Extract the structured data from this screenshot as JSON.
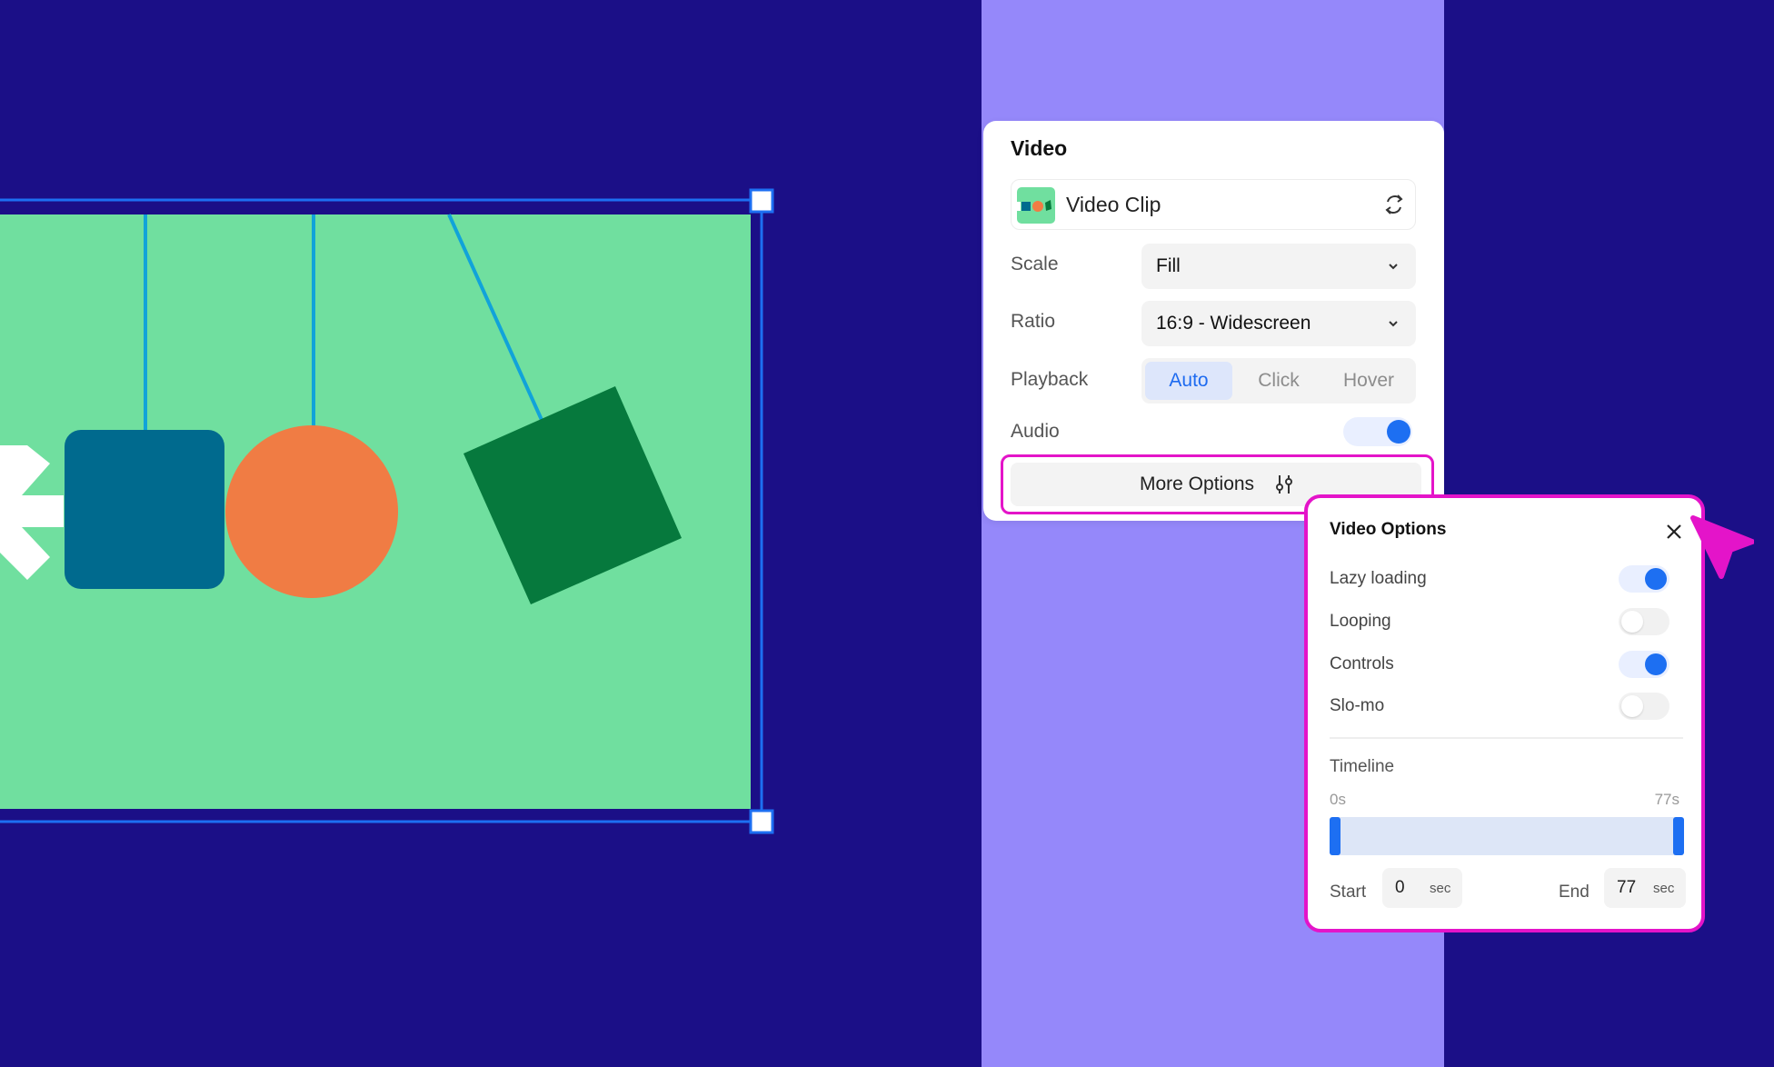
{
  "colors": {
    "background": "#1b0f87",
    "strip": "#9588fa",
    "canvas_green": "#70df9f",
    "selection_blue": "#1d6ff2",
    "highlight_magenta": "#e414c9",
    "square_teal": "#006a8e",
    "circle_orange": "#f07c44",
    "diamond_green": "#06793d",
    "string_cyan": "#11a3d9"
  },
  "video_panel": {
    "title": "Video",
    "clip": {
      "name": "Video Clip",
      "icon": "swap-icon"
    },
    "scale": {
      "label": "Scale",
      "value": "Fill"
    },
    "ratio": {
      "label": "Ratio",
      "value": "16:9 - Widescreen"
    },
    "playback": {
      "label": "Playback",
      "options": [
        "Auto",
        "Click",
        "Hover"
      ],
      "selected": "Auto"
    },
    "audio": {
      "label": "Audio",
      "on": true
    },
    "more_options": {
      "label": "More Options",
      "icon": "sliders-icon"
    }
  },
  "video_options": {
    "title": "Video Options",
    "toggles": [
      {
        "label": "Lazy loading",
        "on": true
      },
      {
        "label": "Looping",
        "on": false
      },
      {
        "label": "Controls",
        "on": true
      },
      {
        "label": "Slo-mo",
        "on": false
      }
    ],
    "timeline": {
      "title": "Timeline",
      "min_label": "0s",
      "max_label": "77s",
      "start_label": "Start",
      "start_value": "0",
      "end_label": "End",
      "end_value": "77",
      "unit": "sec"
    }
  }
}
